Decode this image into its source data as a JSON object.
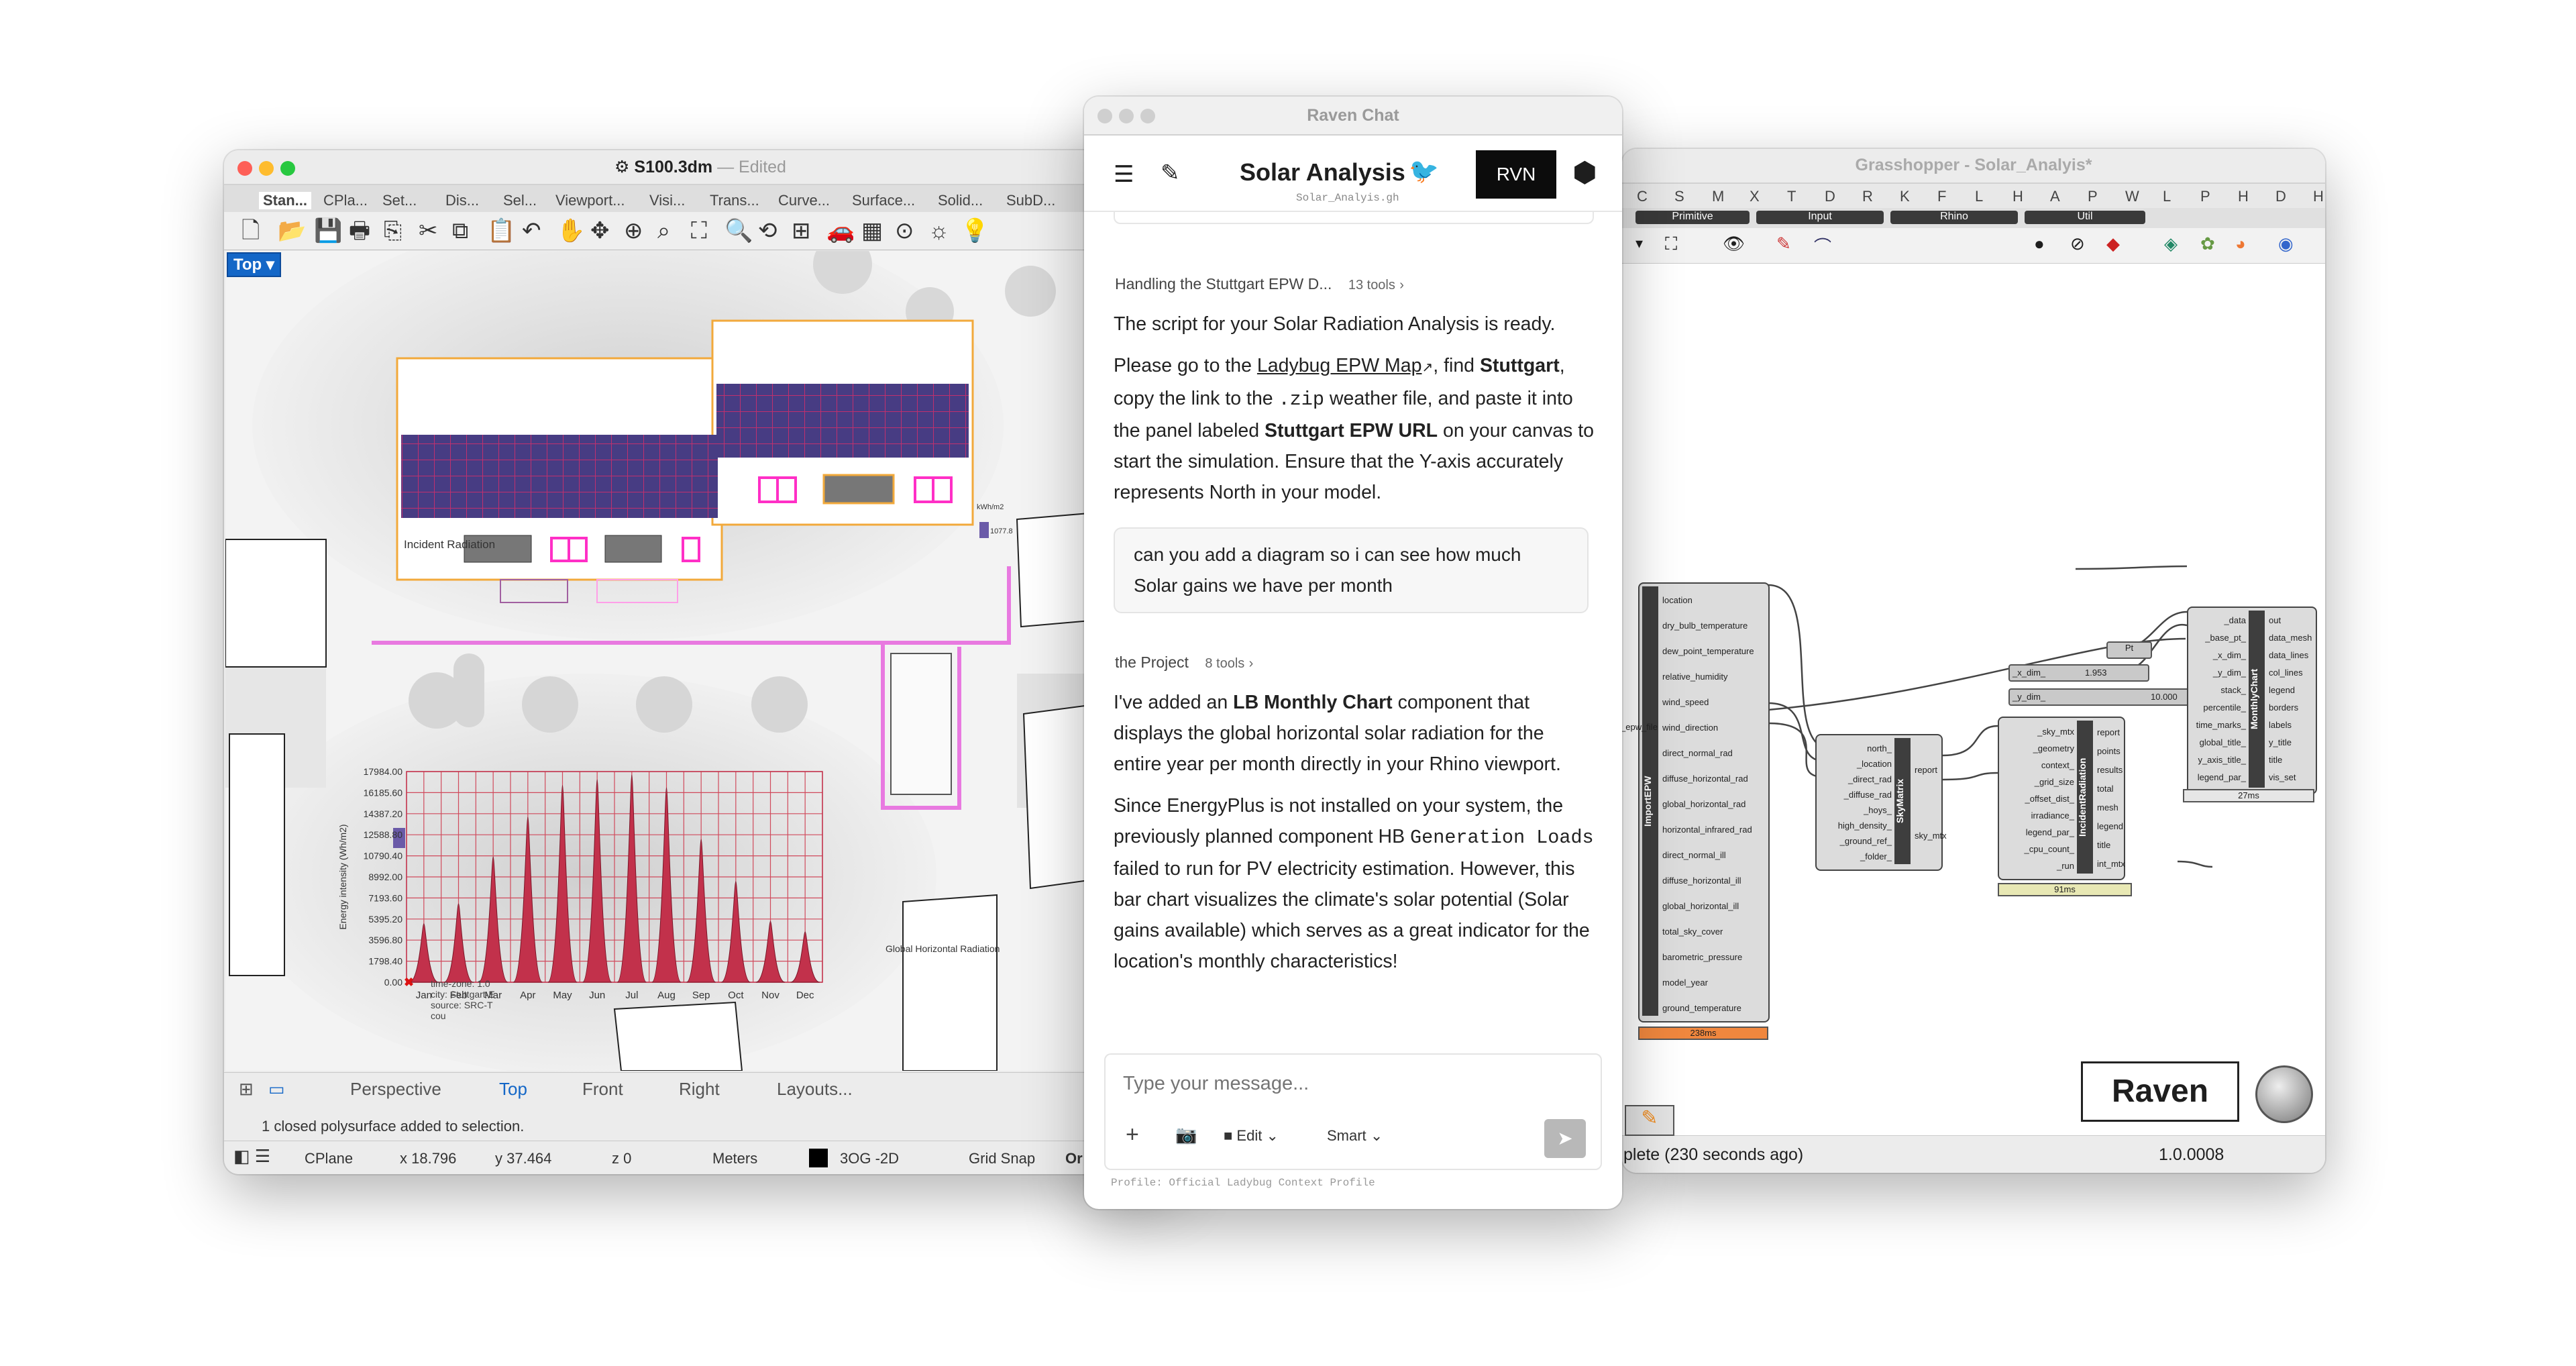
{
  "rhino": {
    "title": "S100.3dm",
    "edited": "— Edited",
    "tabs": [
      "Stan...",
      "CPla...",
      "Set...",
      "Dis...",
      "Sel...",
      "Viewport...",
      "Visi...",
      "Trans...",
      "Curve...",
      "Surface...",
      "Solid...",
      "SubD..."
    ],
    "viewport_label": "Top",
    "incident_label": "Incident Radiation",
    "legend_unit": "kWh/m2",
    "legend_value": "1077.8",
    "view_tabs": [
      "Perspective",
      "Top",
      "Front",
      "Right",
      "Layouts..."
    ],
    "active_view": "Top",
    "command_msg": "1 closed polysurface added to selection.",
    "status": {
      "cplane": "CPlane",
      "x": "x 18.796",
      "y": "y 37.464",
      "z": "z 0",
      "units": "Meters",
      "layer": "3OG -2D",
      "snap": "Grid Snap",
      "ortho": "Or"
    },
    "chart_legend": "Global Horizontal Radiation",
    "chart_info": [
      "time-zone: 1.0",
      "city: Stuttgart-E",
      "source: SRC-T",
      "cou"
    ]
  },
  "chart_data": {
    "type": "area",
    "title": "",
    "ylabel": "Energy intensity (Wh/m2)",
    "y_ticks": [
      17984.0,
      16185.6,
      14387.2,
      12588.8,
      10790.4,
      8992.0,
      7193.6,
      5395.2,
      3596.8,
      1798.4,
      0.0
    ],
    "categories": [
      "Jan",
      "Feb",
      "Mar",
      "Apr",
      "May",
      "Jun",
      "Jul",
      "Aug",
      "Sep",
      "Oct",
      "Nov",
      "Dec"
    ],
    "ylim": [
      0,
      17984
    ],
    "series": [
      {
        "name": "Global Horizontal Radiation",
        "values": [
          5000,
          6700,
          10700,
          14100,
          16800,
          17300,
          17700,
          16600,
          12200,
          8600,
          5200,
          4300
        ]
      }
    ],
    "color": "#c2314b"
  },
  "chat": {
    "window_title": "Raven Chat",
    "app_title": "Solar Analysis",
    "subtitle": "Solar_Analyis.gh",
    "rvn_button": "RVN",
    "step1_title": "Handling the Stuttgart EPW D...",
    "step1_tools": "13 tools",
    "p1": "The script for your Solar Radiation Analysis is ready.",
    "p2_a": "Please go to the ",
    "p2_link": "Ladybug EPW Map",
    "p2_b": ", find ",
    "p2_c": "Stuttgart",
    "p2_d": ", copy the link to the ",
    "p2_code": ".zip",
    "p2_e": " weather file, and paste it into the panel labeled ",
    "p2_f": "Stuttgart EPW URL",
    "p2_g": " on your canvas to start the simulation. Ensure that the Y-axis accurately represents North in your model.",
    "user_msg": "can you add a diagram so i can see how much Solar gains we have per month",
    "step2_title": "the Project",
    "step2_tools": "8 tools",
    "p3_a": "I've added an ",
    "p3_b": "LB Monthly Chart",
    "p3_c": " component that displays the global horizontal solar radiation for the entire year per month directly in your Rhino viewport.",
    "p4_a": "Since EnergyPlus is not installed on your system, the previously planned component HB ",
    "p4_code": "Generation Loads",
    "p4_b": " failed to run for PV electricity estimation. However, this bar chart visualizes the climate's solar potential (Solar gains available) which serves as a great indicator for the location's monthly characteristics!",
    "input_placeholder": "Type your message...",
    "edit_label": "Edit",
    "smart_label": "Smart",
    "profile": "Profile: Official Ladybug Context Profile"
  },
  "gh": {
    "title": "Grasshopper - Solar_Analyis*",
    "menu_letters": [
      "C",
      "S",
      "M",
      "X",
      "T",
      "D",
      "R",
      "K",
      "F",
      "L",
      "H",
      "A",
      "P",
      "W",
      "L",
      "P",
      "H",
      "D",
      "H"
    ],
    "tabs": [
      "Primitive",
      "Input",
      "Rhino",
      "Util"
    ],
    "import_epw": {
      "name": "ImportEPW",
      "input": "_epw_file",
      "outputs": [
        "location",
        "dry_bulb_temperature",
        "dew_point_temperature",
        "relative_humidity",
        "wind_speed",
        "wind_direction",
        "direct_normal_rad",
        "diffuse_horizontal_rad",
        "global_horizontal_rad",
        "horizontal_infrared_rad",
        "direct_normal_ill",
        "diffuse_horizontal_ill",
        "global_horizontal_ill",
        "total_sky_cover",
        "barometric_pressure",
        "model_year",
        "ground_temperature"
      ],
      "time": "238ms"
    },
    "sky_matrix": {
      "name": "SkyMatrix",
      "inputs": [
        "north_",
        "_location",
        "_direct_rad",
        "_diffuse_rad",
        "_hoys_",
        "high_density_",
        "_ground_ref_",
        "_folder_"
      ],
      "outputs": [
        "report",
        "sky_mtx"
      ]
    },
    "incident": {
      "name": "IncidentRadiation",
      "inputs": [
        "_sky_mtx",
        "_geometry",
        "context_",
        "_grid_size",
        "_offset_dist_",
        "irradiance_",
        "legend_par_",
        "_cpu_count_",
        "_run"
      ],
      "outputs": [
        "report",
        "points",
        "results",
        "total",
        "mesh",
        "legend",
        "title",
        "int_mtx"
      ],
      "time": "91ms"
    },
    "monthly": {
      "name": "MonthlyChart",
      "inputs": [
        "_data",
        "_base_pt_",
        "_x_dim_",
        "_y_dim_",
        "stack_",
        "percentile_",
        "time_marks_",
        "global_title_",
        "y_axis_title_",
        "legend_par_"
      ],
      "outputs": [
        "out",
        "data_mesh",
        "data_lines",
        "col_lines",
        "legend",
        "borders",
        "labels",
        "y_title",
        "title",
        "vis_set"
      ],
      "time": "27ms"
    },
    "x_dim": {
      "label": "_x_dim_",
      "value": "1.953"
    },
    "y_dim": {
      "label": "_y_dim_",
      "value": "10.000"
    },
    "pt_label": "Pt",
    "status": "plete (230 seconds ago)",
    "version": "1.0.0008",
    "raven_logo": "Raven"
  }
}
